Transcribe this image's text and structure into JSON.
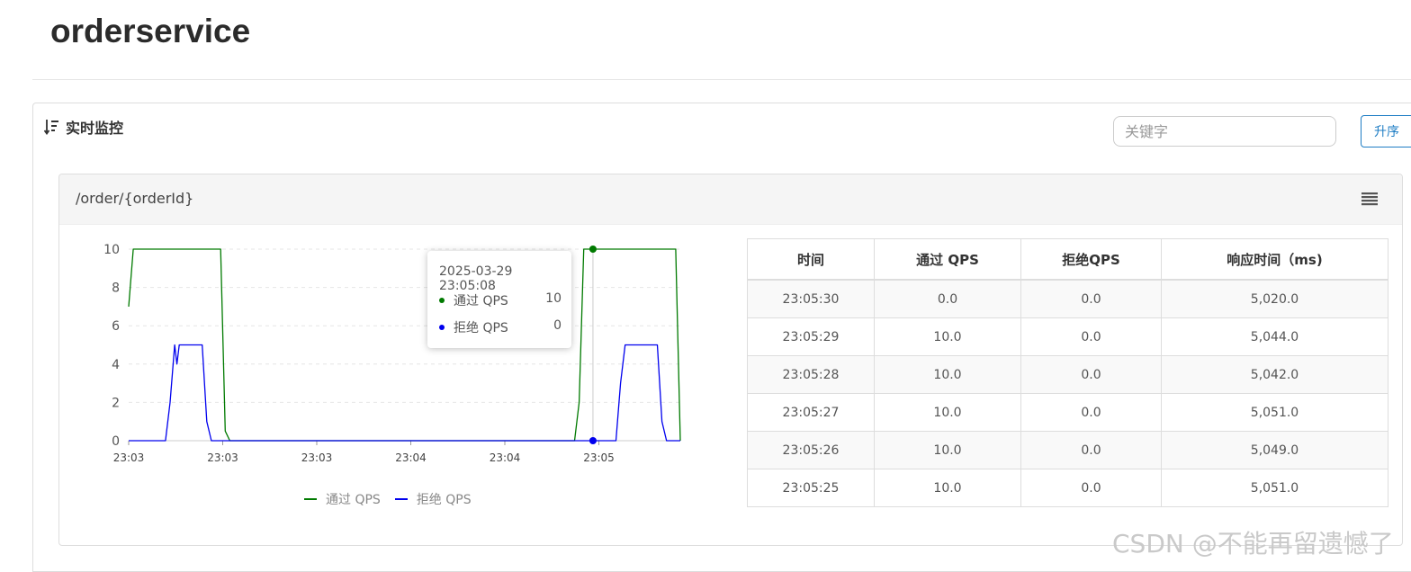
{
  "app": {
    "title": "orderservice"
  },
  "monitor": {
    "heading": "实时监控",
    "search": {
      "placeholder": "关键字",
      "value": ""
    },
    "sort_button_label": "升序"
  },
  "card": {
    "resource_name": "/order/{orderId}",
    "tooltip": {
      "time": "2025-03-29 23:05:08",
      "rows": [
        {
          "label": "通过 QPS",
          "value": "10"
        },
        {
          "label": "拒绝 QPS",
          "value": "0"
        }
      ]
    },
    "table": {
      "headers": [
        "时间",
        "通过 QPS",
        "拒绝QPS",
        "响应时间（ms)"
      ],
      "rows": [
        [
          "23:05:30",
          "0.0",
          "0.0",
          "5,020.0"
        ],
        [
          "23:05:29",
          "10.0",
          "0.0",
          "5,044.0"
        ],
        [
          "23:05:28",
          "10.0",
          "0.0",
          "5,042.0"
        ],
        [
          "23:05:27",
          "10.0",
          "0.0",
          "5,051.0"
        ],
        [
          "23:05:26",
          "10.0",
          "0.0",
          "5,049.0"
        ],
        [
          "23:05:25",
          "10.0",
          "0.0",
          "5,051.0"
        ]
      ]
    }
  },
  "chart_data": {
    "type": "line",
    "y_ticks": [
      "0",
      "2",
      "4",
      "6",
      "8",
      "10"
    ],
    "ylim": [
      0,
      10
    ],
    "x_ticks": [
      "23:03",
      "23:03",
      "23:03",
      "23:04",
      "23:04",
      "23:05"
    ],
    "xlim": [
      0,
      120
    ],
    "grid": true,
    "legend_position": "bottom",
    "series": [
      {
        "name": "通过 QPS",
        "color": "#007a00",
        "points": [
          [
            0,
            7
          ],
          [
            1,
            10
          ],
          [
            20,
            10
          ],
          [
            21,
            0.5
          ],
          [
            22,
            0
          ],
          [
            97,
            0
          ],
          [
            98,
            2
          ],
          [
            99,
            10
          ],
          [
            119,
            10
          ],
          [
            120,
            0
          ]
        ]
      },
      {
        "name": "拒绝 QPS",
        "color": "#0000ee",
        "points": [
          [
            0,
            0
          ],
          [
            8,
            0
          ],
          [
            9,
            2
          ],
          [
            10,
            5
          ],
          [
            10.5,
            4
          ],
          [
            11,
            5
          ],
          [
            16,
            5
          ],
          [
            17,
            1
          ],
          [
            18,
            0
          ],
          [
            106,
            0
          ],
          [
            107,
            3
          ],
          [
            108,
            5
          ],
          [
            115,
            5
          ],
          [
            116,
            1
          ],
          [
            117,
            0
          ],
          [
            120,
            0
          ]
        ]
      }
    ],
    "highlight": {
      "x": 101,
      "values": [
        10,
        0
      ]
    },
    "colors": {
      "pass": "#007a00",
      "block": "#0000ee",
      "accent": "#1e7dc4"
    }
  },
  "watermark": "CSDN @不能再留遗憾了"
}
